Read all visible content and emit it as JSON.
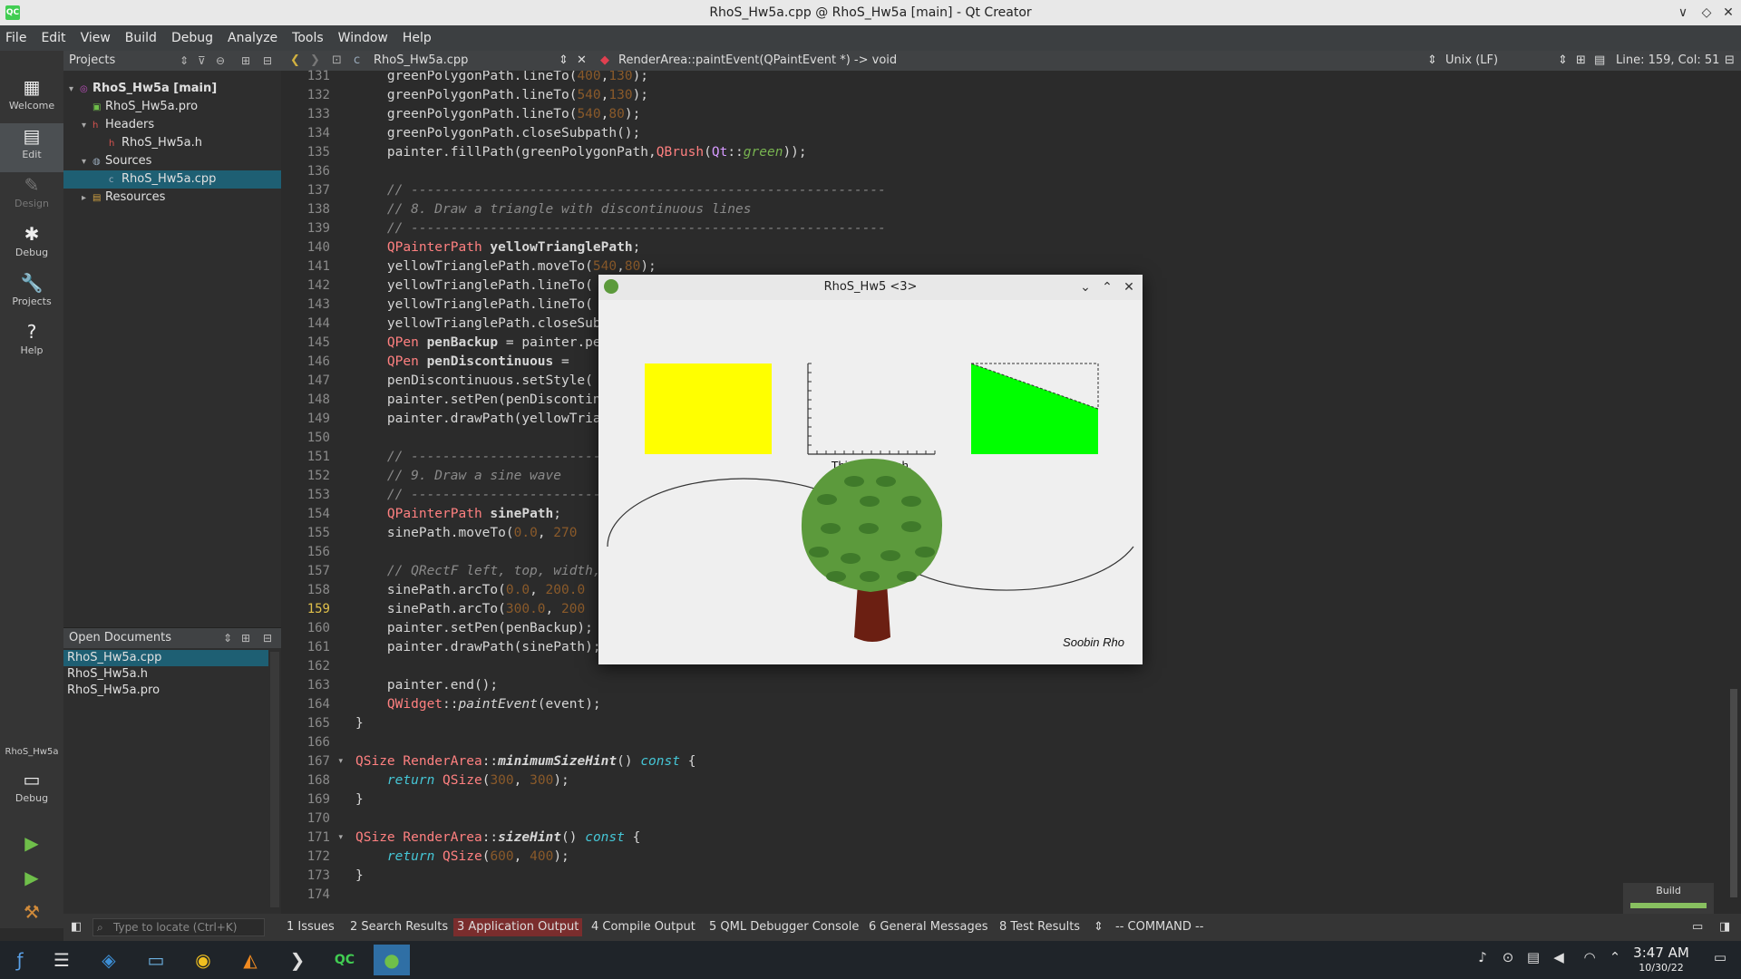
{
  "window": {
    "title": "RhoS_Hw5a.cpp @ RhoS_Hw5a [main] - Qt Creator",
    "app_icon": "QC",
    "controls": [
      "∨",
      "◇",
      "✕"
    ]
  },
  "menu": [
    "File",
    "Edit",
    "View",
    "Build",
    "Debug",
    "Analyze",
    "Tools",
    "Window",
    "Help"
  ],
  "modes": [
    {
      "label": "Welcome",
      "icon": "▦"
    },
    {
      "label": "Edit",
      "icon": "▤"
    },
    {
      "label": "Design",
      "icon": "✎"
    },
    {
      "label": "Debug",
      "icon": "✱"
    },
    {
      "label": "Projects",
      "icon": "🔧"
    },
    {
      "label": "Help",
      "icon": "?"
    }
  ],
  "kit": {
    "name": "RhoS_Hw5a",
    "mode": "Debug"
  },
  "projects": {
    "header": "Projects",
    "tree": [
      {
        "label": "RhoS_Hw5a [main]",
        "depth": 0
      },
      {
        "label": "RhoS_Hw5a.pro",
        "depth": 1
      },
      {
        "label": "Headers",
        "depth": 1
      },
      {
        "label": "RhoS_Hw5a.h",
        "depth": 2
      },
      {
        "label": "Sources",
        "depth": 1
      },
      {
        "label": "RhoS_Hw5a.cpp",
        "depth": 2
      },
      {
        "label": "Resources",
        "depth": 1
      }
    ]
  },
  "open_documents": {
    "header": "Open Documents",
    "items": [
      "RhoS_Hw5a.cpp",
      "RhoS_Hw5a.h",
      "RhoS_Hw5a.pro"
    ]
  },
  "editor": {
    "file": "RhoS_Hw5a.cpp",
    "function": "RenderArea::paintEvent(QPaintEvent *) -> void",
    "line_ending": "Unix (LF)",
    "cursor": "Line: 159, Col: 51",
    "first_line": 131,
    "current_line": 159
  },
  "app_window": {
    "title": "RhoS_Hw5 <3>",
    "graph_caption": "This is a graph.",
    "signature": "Soobin Rho",
    "colors": {
      "yellow": "#ffff00",
      "green": "#00ff00",
      "canopy": "#5c9a3c",
      "spots": "#3f7a2a",
      "trunk": "#6b1f12",
      "background": "#efefef"
    }
  },
  "output_bar": {
    "locate_placeholder": "Type to locate (Ctrl+K)",
    "tabs": [
      "1  Issues",
      "2  Search Results",
      "3  Application Output",
      "4  Compile Output",
      "5  QML Debugger Console",
      "6  General Messages",
      "8  Test Results"
    ],
    "active_tab": 2,
    "mode_text": "-- COMMAND --"
  },
  "build_progress": {
    "label": "Build",
    "fraction": 1.0
  },
  "taskbar": {
    "time": "3:47 AM",
    "date": "10/30/22"
  }
}
